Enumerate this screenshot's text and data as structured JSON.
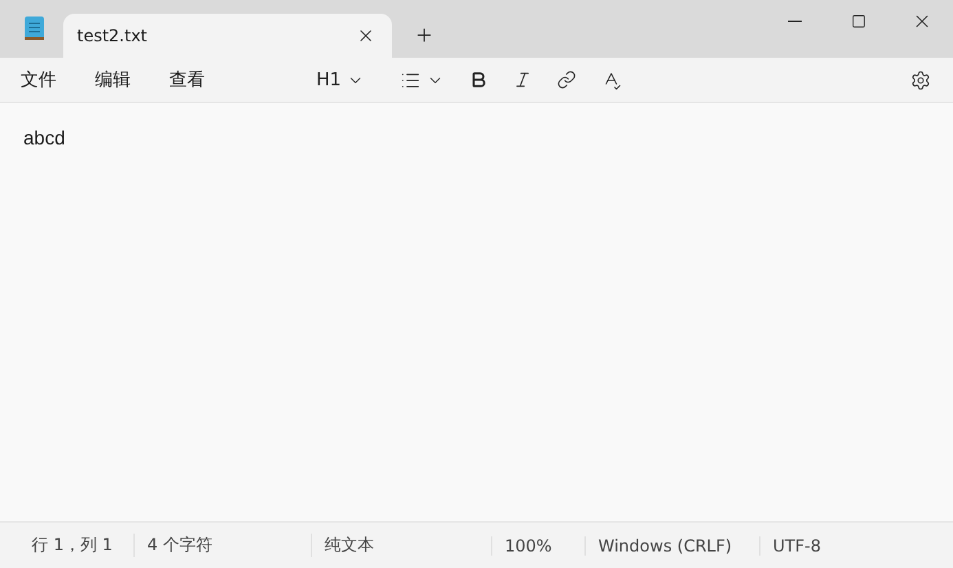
{
  "tab": {
    "title": "test2.txt",
    "selected": true
  },
  "menu": [
    "文件",
    "编辑",
    "查看"
  ],
  "heading_dropdown": {
    "label": "H1"
  },
  "editor": {
    "text": "abcd"
  },
  "status_bar": [
    "行 1，列 1",
    "4 个字符",
    "纯文本",
    "100%",
    "Windows (CRLF)",
    "UTF-8"
  ]
}
